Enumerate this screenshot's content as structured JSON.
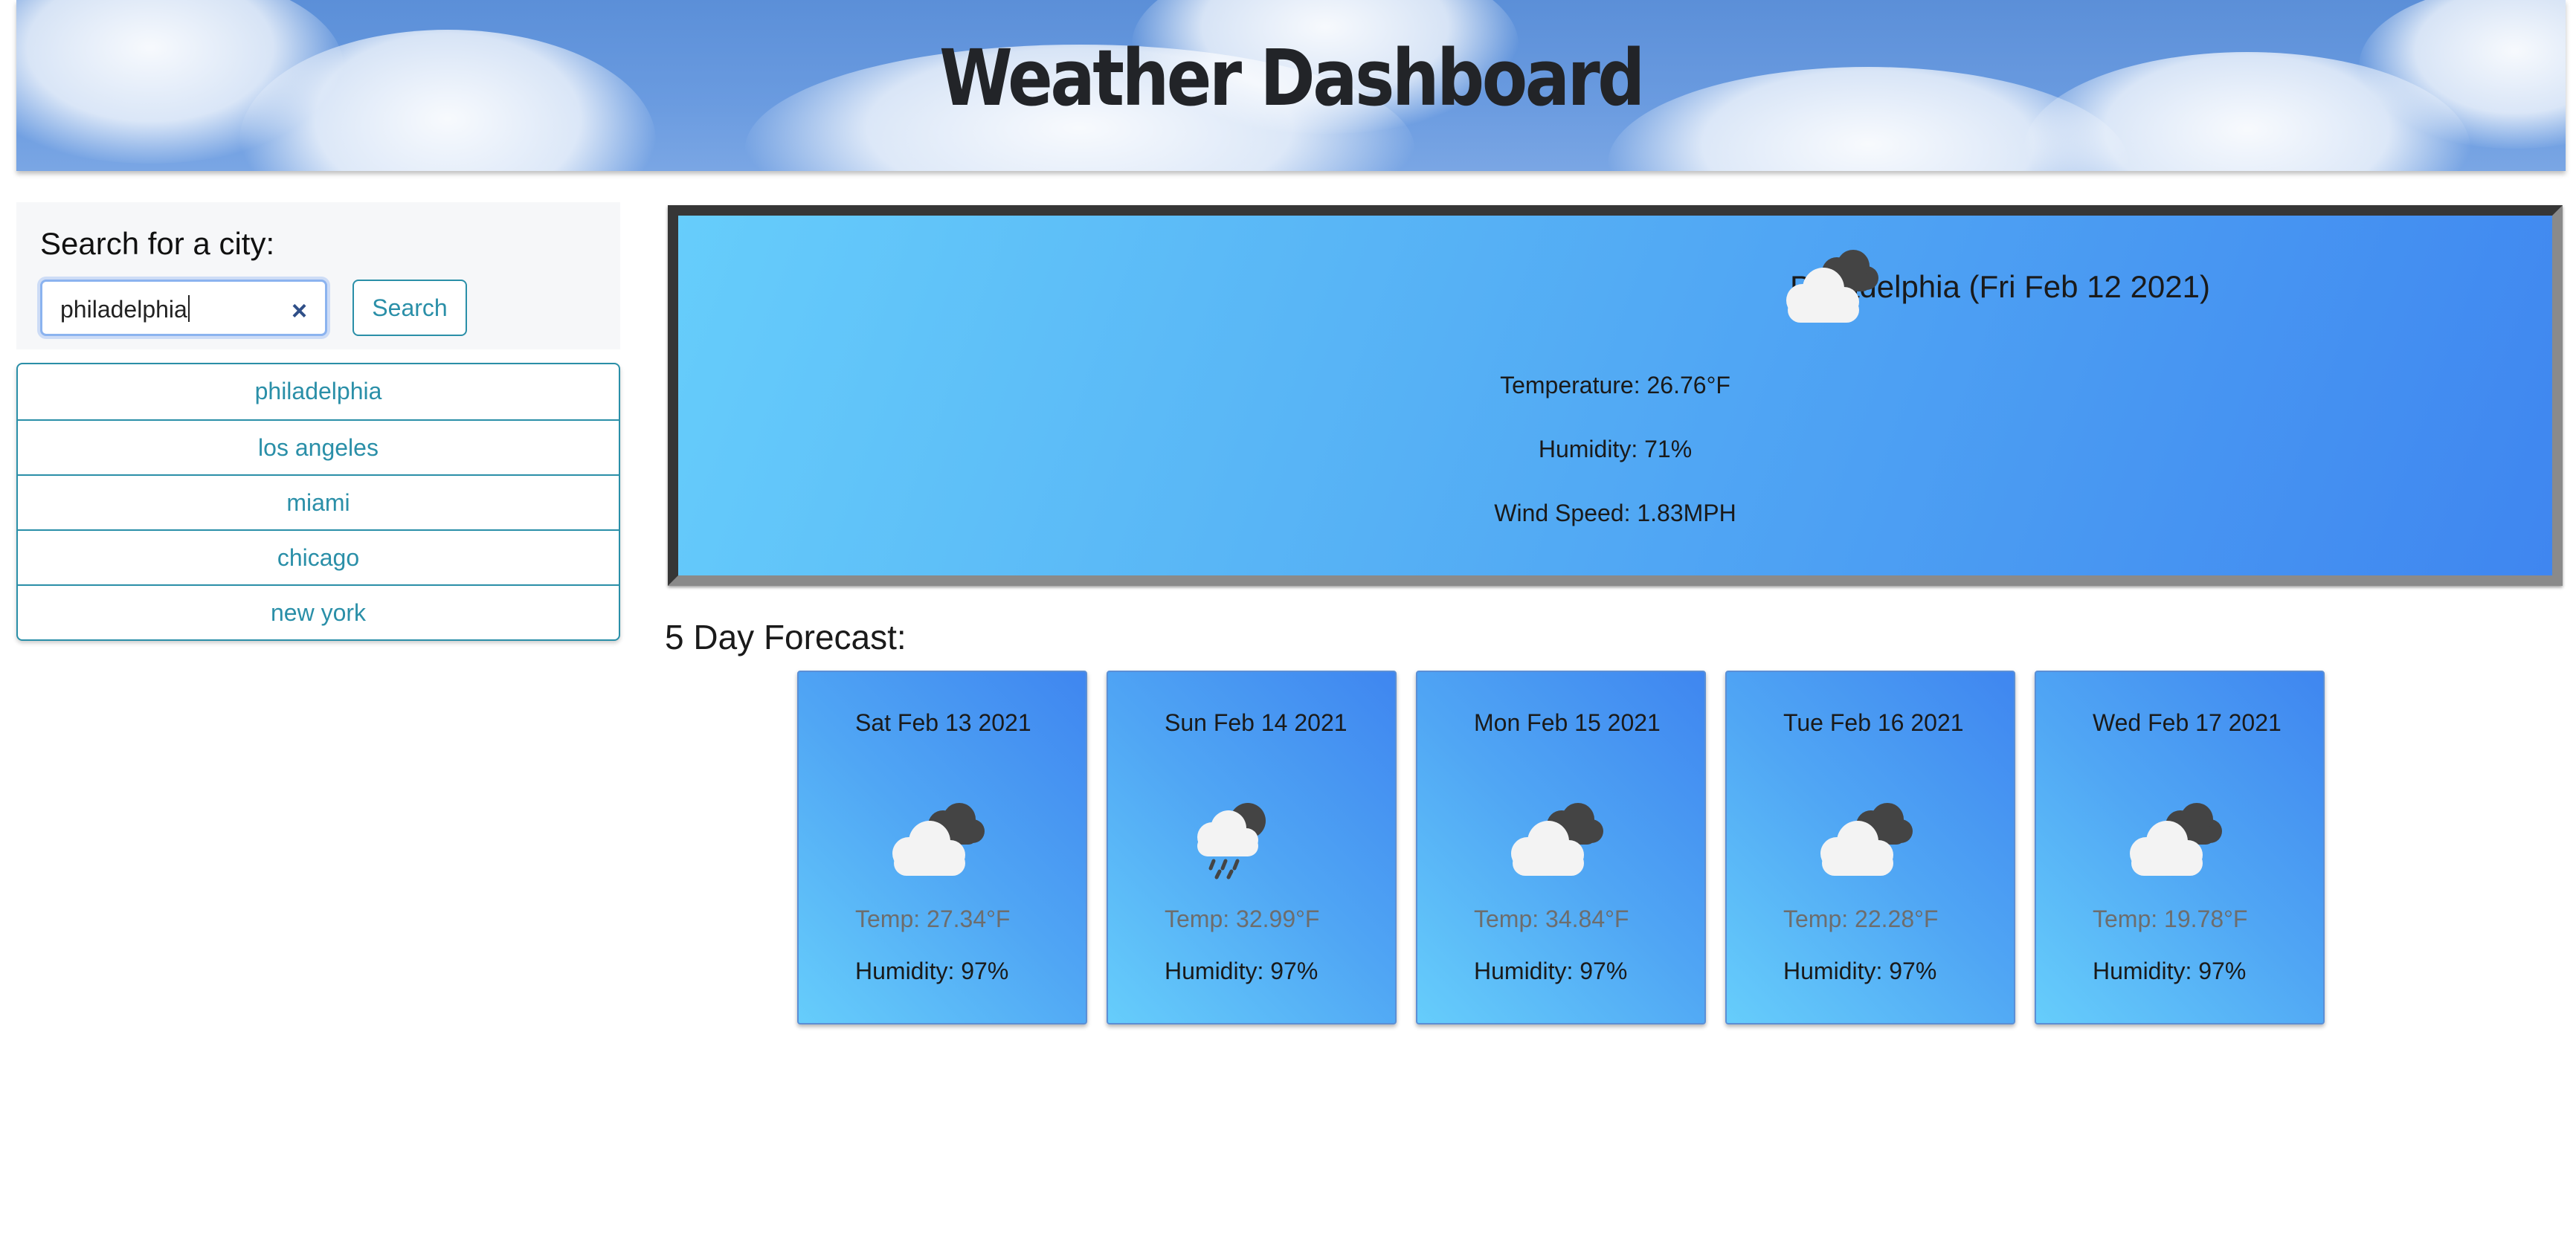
{
  "header": {
    "title": "Weather Dashboard"
  },
  "search": {
    "label": "Search for a city:",
    "value": "philadelphia",
    "clear_icon": "×",
    "button_label": "Search"
  },
  "history": [
    "philadelphia",
    "los angeles",
    "miami",
    "chicago",
    "new york"
  ],
  "current": {
    "title": "Philadelphia (Fri Feb 12 2021)",
    "icon": "cloudy-icon",
    "temperature": "Temperature: 26.76°F",
    "humidity": "Humidity: 71%",
    "wind": "Wind Speed: 1.83MPH"
  },
  "forecast": {
    "title": "5 Day Forecast:",
    "days": [
      {
        "date": "Sat Feb 13 2021",
        "icon": "cloudy-icon",
        "temp": "Temp: 27.34°F",
        "humidity": "Humidity: 97%"
      },
      {
        "date": "Sun Feb 14 2021",
        "icon": "rain-icon",
        "temp": "Temp: 32.99°F",
        "humidity": "Humidity: 97%"
      },
      {
        "date": "Mon Feb 15 2021",
        "icon": "cloudy-icon",
        "temp": "Temp: 34.84°F",
        "humidity": "Humidity: 97%"
      },
      {
        "date": "Tue Feb 16 2021",
        "icon": "cloudy-icon",
        "temp": "Temp: 22.28°F",
        "humidity": "Humidity: 97%"
      },
      {
        "date": "Wed Feb 17 2021",
        "icon": "cloudy-icon",
        "temp": "Temp: 19.78°F",
        "humidity": "Humidity: 97%"
      }
    ]
  },
  "colors": {
    "accent": "#2a8fa8",
    "card_gradient_start": "#66cdfb",
    "card_gradient_end": "#3f86f0"
  }
}
